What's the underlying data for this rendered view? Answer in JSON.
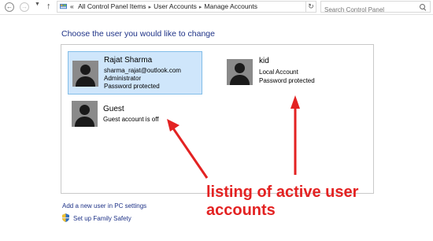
{
  "address_bar": {
    "crumbs": [
      "All Control Panel Items",
      "User Accounts",
      "Manage Accounts"
    ],
    "overflow": "«",
    "search_placeholder": "Search Control Panel"
  },
  "heading": "Choose the user you would like to change",
  "users": [
    {
      "name": "Rajat Sharma",
      "lines": [
        "sharma_rajat@outlook.com",
        "Administrator",
        "Password protected"
      ],
      "selected": true
    },
    {
      "name": "kid",
      "lines": [
        "Local Account",
        "Password protected"
      ],
      "selected": false
    },
    {
      "name": "Guest",
      "lines": [
        "Guest account is off"
      ],
      "selected": false
    }
  ],
  "links": {
    "add_user": "Add a new user in PC settings",
    "family_safety": "Set up Family Safety"
  },
  "annotation": {
    "line1": "listing of active user",
    "line2": "accounts"
  },
  "colors": {
    "link": "#1e3287",
    "selected_fill": "#cfe6fb",
    "annotation": "#e32222"
  }
}
